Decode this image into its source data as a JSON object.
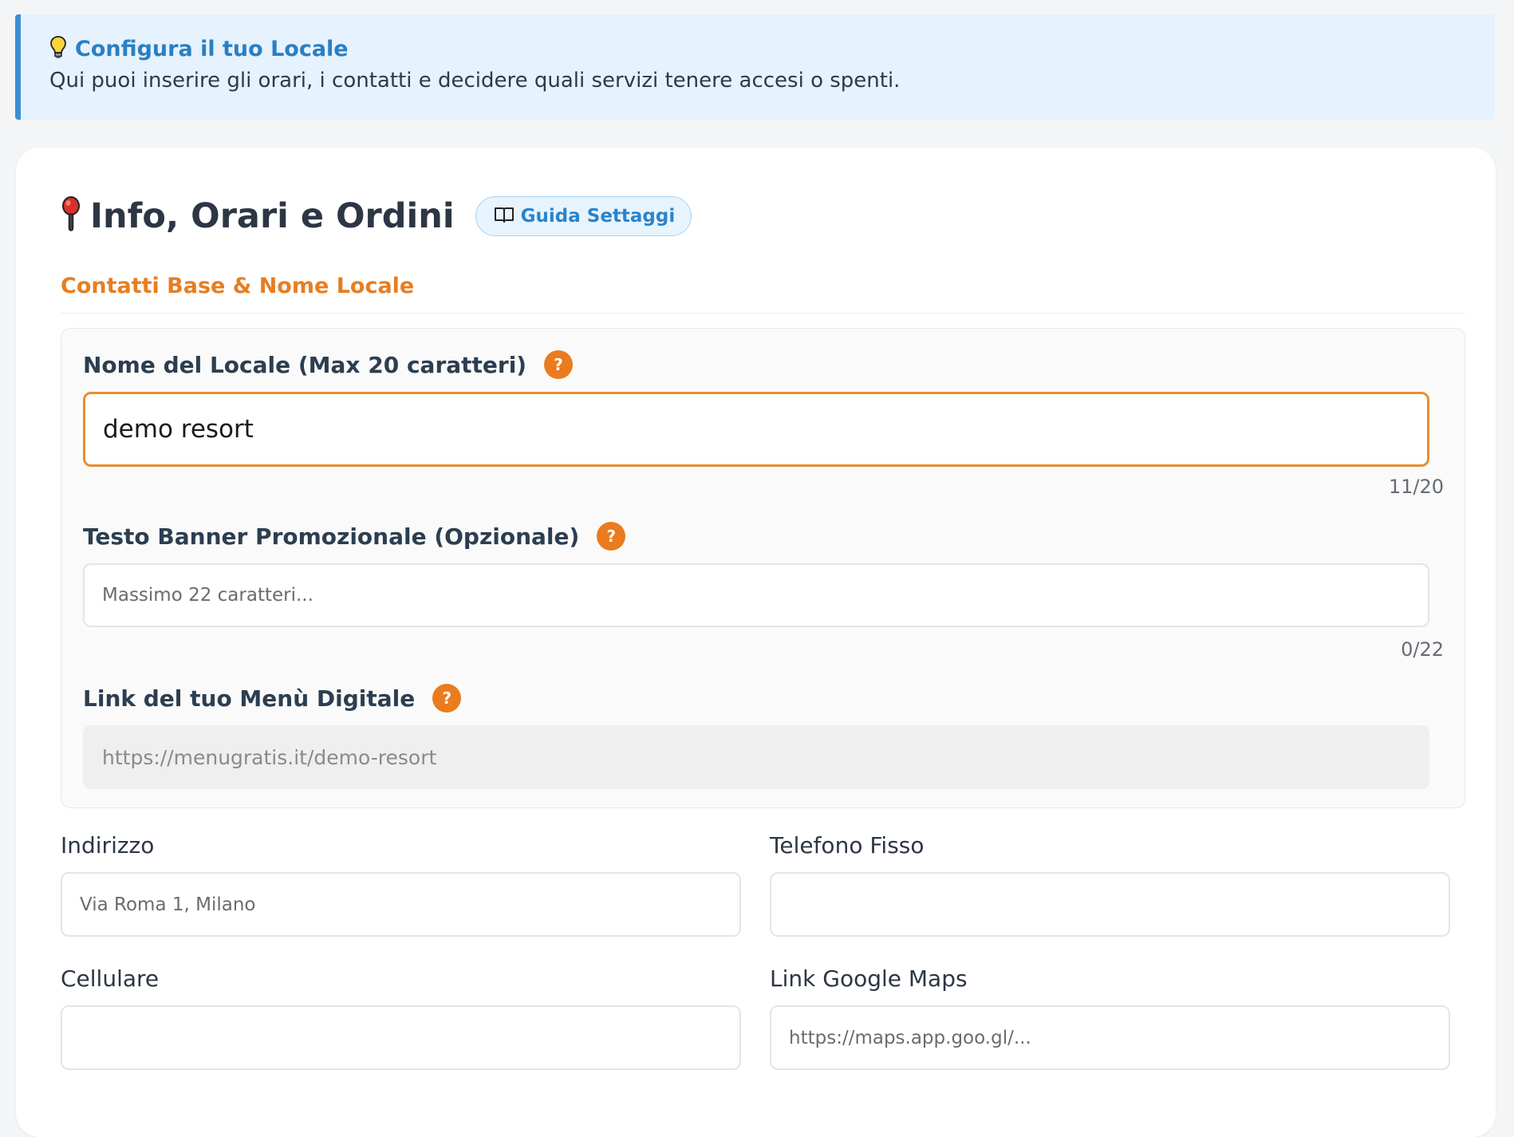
{
  "banner": {
    "icon": "lightbulb-icon",
    "title": "Configura il tuo Locale",
    "text": "Qui puoi inserire gli orari, i contatti e decidere quali servizi tenere accesi o spenti."
  },
  "header": {
    "icon": "pushpin-icon",
    "title": "Info, Orari e Ordini",
    "guide_button": "Guida Settaggi",
    "guide_icon": "book-icon"
  },
  "section": {
    "title": "Contatti Base & Nome Locale"
  },
  "fields": {
    "name": {
      "label": "Nome del Locale (Max 20 caratteri)",
      "value": "demo resort",
      "counter": "11/20"
    },
    "banner_text": {
      "label": "Testo Banner Promozionale (Opzionale)",
      "placeholder": "Massimo 22 caratteri...",
      "counter": "0/22"
    },
    "menu_link": {
      "label": "Link del tuo Menù Digitale",
      "value": "https://menugratis.it/demo-resort"
    },
    "address": {
      "label": "Indirizzo",
      "placeholder": "Via Roma 1, Milano"
    },
    "landline": {
      "label": "Telefono Fisso",
      "placeholder": ""
    },
    "mobile": {
      "label": "Cellulare",
      "placeholder": ""
    },
    "maps": {
      "label": "Link Google Maps",
      "placeholder": "https://maps.app.goo.gl/..."
    }
  },
  "help_symbol": "?",
  "colors": {
    "accent_orange": "#e67e22",
    "accent_blue": "#2a7fc2",
    "banner_bg": "#e6f2fd"
  }
}
